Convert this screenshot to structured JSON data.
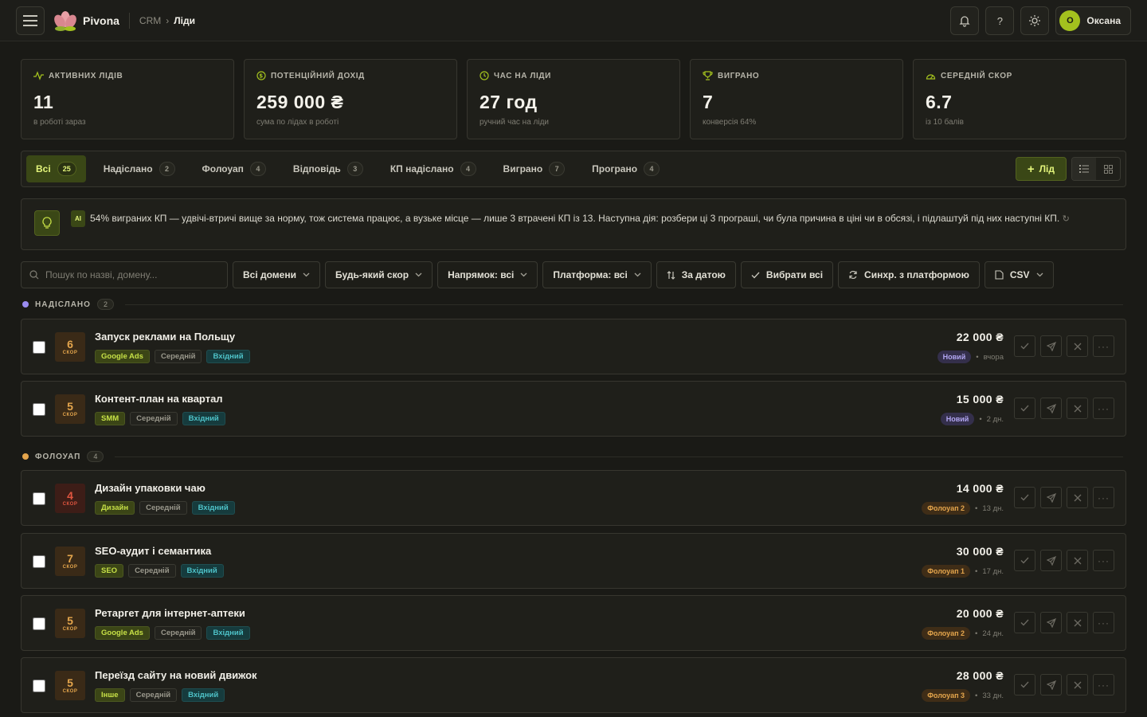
{
  "app": {
    "name": "Pivona"
  },
  "breadcrumb": {
    "root": "CRM",
    "current": "Ліди"
  },
  "user": {
    "initial": "О",
    "name": "Оксана"
  },
  "stats": [
    {
      "icon": "pulse-icon",
      "label": "Активних лідів",
      "value": "11",
      "sub": "в роботі зараз"
    },
    {
      "icon": "coin-icon",
      "label": "Потенційний дохід",
      "value": "259 000 ₴",
      "sub": "сума по лідах в роботі"
    },
    {
      "icon": "clock-icon",
      "label": "Час на ліди",
      "value": "27 год",
      "sub": "ручний час на ліди"
    },
    {
      "icon": "trophy-icon",
      "label": "Виграно",
      "value": "7",
      "sub": "конверсія 64%"
    },
    {
      "icon": "gauge-icon",
      "label": "Середній скор",
      "value": "6.7",
      "sub": "із 10 балів"
    }
  ],
  "tabs": [
    {
      "label": "Всі",
      "count": "25",
      "active": true
    },
    {
      "label": "Надіслано",
      "count": "2"
    },
    {
      "label": "Фолоуап",
      "count": "4"
    },
    {
      "label": "Відповідь",
      "count": "3"
    },
    {
      "label": "КП надіслано",
      "count": "4"
    },
    {
      "label": "Виграно",
      "count": "7"
    },
    {
      "label": "Програно",
      "count": "4"
    }
  ],
  "add_button": "Лід",
  "ai": {
    "badge": "AI",
    "text": "54% виграних КП — удвічі-втричі вище за норму, тож система працює, а вузьке місце — лише 3 втрачені КП із 13. Наступна дія: розбери ці 3 програші, чи була причина в ціні чи в обсязі, і підлаштуй під них наступні КП.",
    "refresh": "↻"
  },
  "search": {
    "placeholder": "Пошук по назві, домену..."
  },
  "filters": {
    "domains": "Всі домени",
    "score": "Будь-який скор",
    "direction": "Напрямок: всі",
    "platform": "Платформа: всі",
    "sort": "За датою",
    "select_all": "Вибрати всі",
    "sync": "Синхр. з платформою",
    "csv": "CSV"
  },
  "sections": [
    {
      "title": "Надіслано",
      "count": "2",
      "color": "#9b8cf0"
    },
    {
      "title": "Фолоуап",
      "count": "4",
      "color": "#e4a54c"
    }
  ],
  "score_label": "скор",
  "leads": [
    {
      "score": "6",
      "title": "Запуск реклами на Польщу",
      "category": "Google Ads",
      "priority": "Середній",
      "direction": "Вхідний",
      "amount": "22 000 ₴",
      "status": "Новий",
      "time": "вчора"
    },
    {
      "score": "5",
      "title": "Контент-план на квартал",
      "category": "SMM",
      "priority": "Середній",
      "direction": "Вхідний",
      "amount": "15 000 ₴",
      "status": "Новий",
      "time": "2 дн."
    },
    {
      "score": "4",
      "title": "Дизайн упаковки чаю",
      "category": "Дизайн",
      "priority": "Середній",
      "direction": "Вхідний",
      "amount": "14 000 ₴",
      "status": "Фолоуап 2",
      "time": "13 дн."
    },
    {
      "score": "7",
      "title": "SEO-аудит і семантика",
      "category": "SEO",
      "priority": "Середній",
      "direction": "Вхідний",
      "amount": "30 000 ₴",
      "status": "Фолоуап 1",
      "time": "17 дн."
    },
    {
      "score": "5",
      "title": "Ретаргет для інтернет-аптеки",
      "category": "Google Ads",
      "priority": "Середній",
      "direction": "Вхідний",
      "amount": "20 000 ₴",
      "status": "Фолоуап 2",
      "time": "24 дн."
    },
    {
      "score": "5",
      "title": "Переїзд сайту на новий движок",
      "category": "Інше",
      "priority": "Середній",
      "direction": "Вхідний",
      "amount": "28 000 ₴",
      "status": "Фолоуап 3",
      "time": "33 дн."
    }
  ]
}
